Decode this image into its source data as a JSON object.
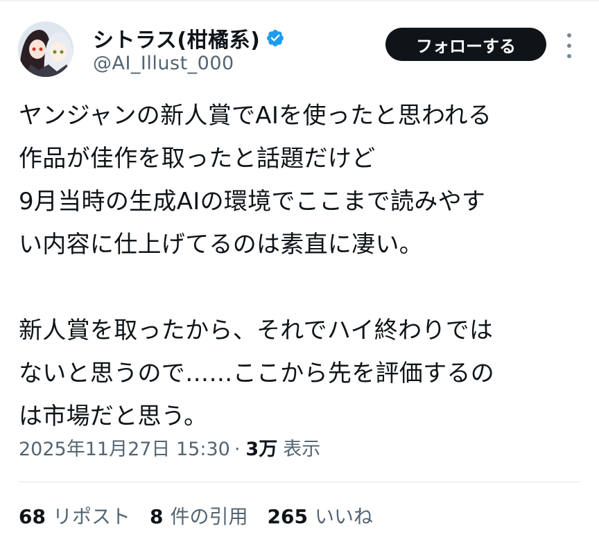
{
  "author": {
    "display_name": "シトラス(柑橘系)",
    "handle": "@AI_Illust_000",
    "verified_icon": "verified-badge-icon"
  },
  "actions": {
    "follow_label": "フォローする",
    "more_icon": "more-vertical-icon"
  },
  "tweet": {
    "text": "ヤンジャンの新人賞でAIを使ったと思われる\n作品が佳作を取ったと話題だけど\n9月当時の生成AIの環境でここまで読みやす\nい内容に仕上げてるのは素直に凄い。\n\n新人賞を取ったから、それでハイ終わりでは\nないと思うので……ここから先を評価するの\nは市場だと思う。",
    "timestamp": "2025年11月27日 15:30",
    "separator": "·",
    "views_count": "3万",
    "views_label": "表示"
  },
  "stats": [
    {
      "count": "68",
      "label": "リポスト"
    },
    {
      "count": "8",
      "label": "件の引用"
    },
    {
      "count": "265",
      "label": "いいね"
    }
  ],
  "colors": {
    "text": "#0f1419",
    "secondary": "#536471",
    "verified": "#1d9bf0",
    "follow_bg": "#0f1419"
  }
}
